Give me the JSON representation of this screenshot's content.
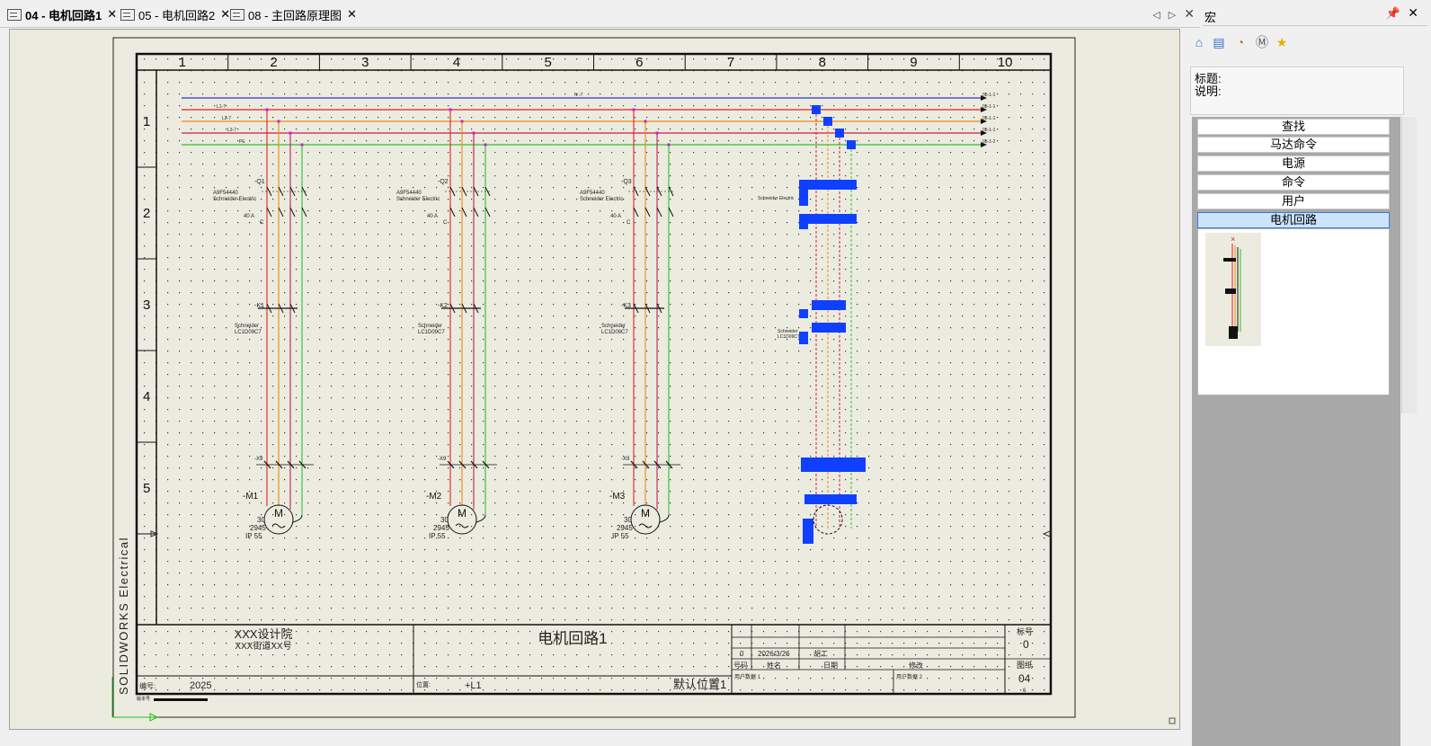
{
  "tabs": [
    {
      "label": "04 - 电机回路1",
      "active": true
    },
    {
      "label": "05 - 电机回路2",
      "active": false
    },
    {
      "label": "08 - 主回路原理图",
      "active": false
    }
  ],
  "drawing": {
    "columns": [
      "1",
      "2",
      "3",
      "4",
      "5",
      "6",
      "7",
      "8",
      "9",
      "10"
    ],
    "rows": [
      "1",
      "2",
      "3",
      "4",
      "5"
    ],
    "bus_labels": {
      "n": "N -7",
      "l1": "L1-7",
      "l2": "L2-7",
      "l3": "L3-7",
      "pe": "PE"
    },
    "bus_refs": [
      "05-1-1",
      "05-1-1",
      "05-1-1",
      "05-1-1",
      "05-1-2"
    ],
    "vertical_brand": "SOLIDWORKS Electrical",
    "circuits": [
      {
        "breaker": "-Q1",
        "contactor": "-K1",
        "terminal": "-X9",
        "motor": "-M1",
        "breaker_model": "A9F54440",
        "maker": "Schneider Electric",
        "rating": "40 A",
        "curve": "C",
        "contactor_maker": "Schneider",
        "contactor_model": "LC1D09C7",
        "motor_power": "30",
        "motor_speed": "2945",
        "motor_ip": "IP 55"
      },
      {
        "breaker": "-Q2",
        "contactor": "-K2",
        "terminal": "-X9",
        "motor": "-M2",
        "breaker_model": "A9F54440",
        "maker": "Schneider Electric",
        "rating": "40 A",
        "curve": "C",
        "contactor_maker": "Schneider",
        "contactor_model": "LC1D09C7",
        "motor_power": "30",
        "motor_speed": "2945",
        "motor_ip": "IP 55"
      },
      {
        "breaker": "-Q3",
        "contactor": "-K3",
        "terminal": "-X9",
        "motor": "-M3",
        "breaker_model": "A9F54440",
        "maker": "Schneider Electric",
        "rating": "40 A",
        "curve": "C",
        "contactor_maker": "Schneider",
        "contactor_model": "LC1D09C7",
        "motor_power": "30",
        "motor_speed": "2945",
        "motor_ip": "IP 55"
      }
    ],
    "motor_symbol": "M",
    "title_block": {
      "company": "XXX设计院",
      "address": "XXX街道XX号",
      "drawing_title": "电机回路1",
      "number_label": "编号:",
      "number_value": "2025",
      "location_label": "位置:",
      "location_value": "+L1",
      "default_location": "默认位置1",
      "rev_index": "0",
      "rev_date": "2026/3/26",
      "rev_author": "胡工",
      "hdr_no": "号码",
      "hdr_name": "姓名",
      "hdr_date": "日期",
      "hdr_mod": "修改",
      "user_data1": "用户数据 1",
      "user_data2": "用户数据 2",
      "mark_label": "标号",
      "mark_value": "0",
      "sheet_label": "图纸",
      "sheet_value": "04",
      "sheet_total": "6",
      "version_label": "版本号"
    }
  },
  "panel": {
    "title": "宏",
    "info_title_label": "标题:",
    "info_desc_label": "说明:",
    "categories": [
      "查找",
      "马达命令",
      "电源",
      "命令",
      "用户",
      "电机回路"
    ],
    "selected_category": "电机回路"
  },
  "colors": {
    "n": "#3030e0",
    "l1": "#e02020",
    "l2": "#f08a10",
    "l3": "#c02050",
    "pe": "#30c030",
    "selection": "#1040ff",
    "magenta": "#d020d0"
  }
}
